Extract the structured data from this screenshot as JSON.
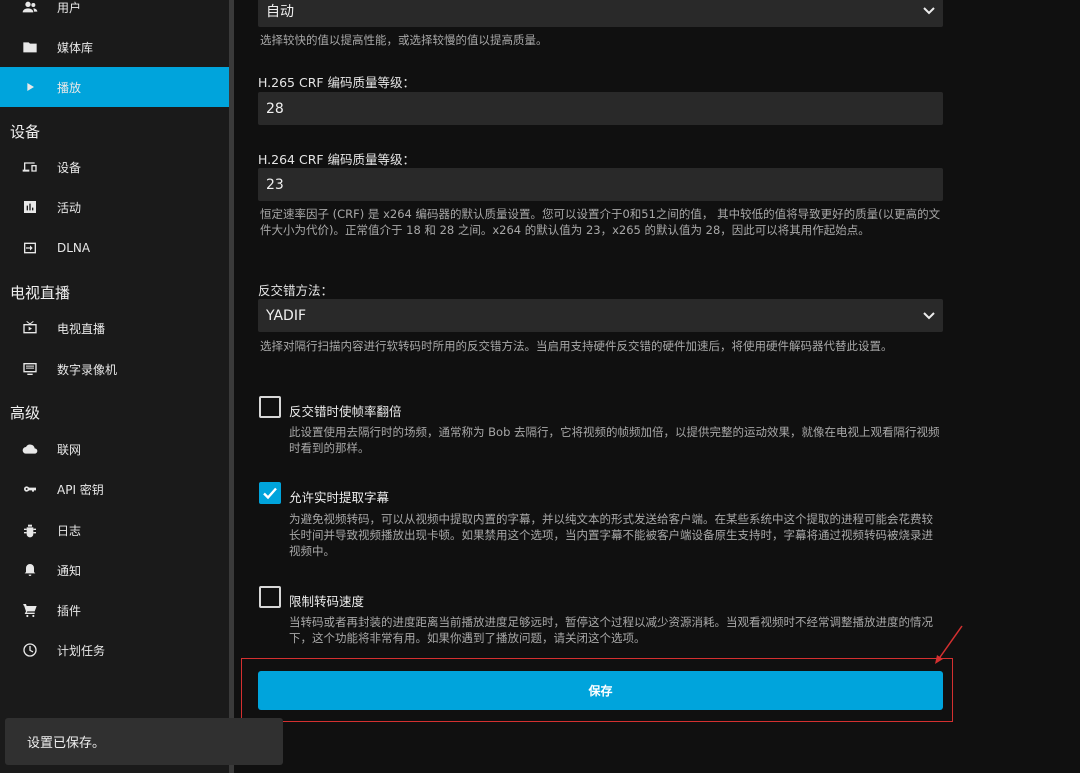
{
  "sidebar": {
    "items": [
      {
        "label": "用户",
        "icon": "users-icon",
        "active": false
      },
      {
        "label": "媒体库",
        "icon": "folder-icon",
        "active": false
      },
      {
        "label": "播放",
        "icon": "play-icon",
        "active": true
      }
    ],
    "sections": [
      {
        "title": "设备",
        "items": [
          {
            "label": "设备",
            "icon": "devices-icon"
          },
          {
            "label": "活动",
            "icon": "activity-icon"
          },
          {
            "label": "DLNA",
            "icon": "dlna-icon"
          }
        ]
      },
      {
        "title": "电视直播",
        "items": [
          {
            "label": "电视直播",
            "icon": "live-tv-icon"
          },
          {
            "label": "数字录像机",
            "icon": "dvr-icon"
          }
        ]
      },
      {
        "title": "高级",
        "items": [
          {
            "label": "联网",
            "icon": "cloud-icon"
          },
          {
            "label": "API 密钥",
            "icon": "key-icon"
          },
          {
            "label": "日志",
            "icon": "bug-icon"
          },
          {
            "label": "通知",
            "icon": "bell-icon"
          },
          {
            "label": "插件",
            "icon": "cart-icon"
          },
          {
            "label": "计划任务",
            "icon": "clock-icon"
          }
        ]
      }
    ]
  },
  "form": {
    "preset": {
      "value": "自动",
      "help": "选择较快的值以提高性能，或选择较慢的值以提高质量。"
    },
    "h265_crf": {
      "label": "H.265 CRF 编码质量等级：",
      "value": "28"
    },
    "h264_crf": {
      "label": "H.264 CRF 编码质量等级：",
      "value": "23",
      "help": "恒定速率因子 (CRF) 是 x264 编码器的默认质量设置。您可以设置介于0和51之间的值， 其中较低的值将导致更好的质量(以更高的文件大小为代价)。正常值介于 18 和 28 之间。x264 的默认值为 23，x265 的默认值为 28，因此可以将其用作起始点。"
    },
    "deinterlace": {
      "label": "反交错方法：",
      "value": "YADIF",
      "help": "选择对隔行扫描内容进行软转码时所用的反交错方法。当启用支持硬件反交错的硬件加速后，将使用硬件解码器代替此设置。"
    },
    "double_rate": {
      "label": "反交错时使帧率翻倍",
      "checked": false,
      "help": "此设置使用去隔行时的场频，通常称为 Bob 去隔行，它将视频的帧频加倍，以提供完整的运动效果，就像在电视上观看隔行视频时看到的那样。"
    },
    "extract_subs": {
      "label": "允许实时提取字幕",
      "checked": true,
      "help": "为避免视频转码，可以从视频中提取内置的字幕，并以纯文本的形式发送给客户端。在某些系统中这个提取的进程可能会花费较长时间并导致视频播放出现卡顿。如果禁用这个选项，当内置字幕不能被客户端设备原生支持时，字幕将通过视频转码被烧录进视频中。"
    },
    "throttle": {
      "label": "限制转码速度",
      "checked": false,
      "help": "当转码或者再封装的进度距离当前播放进度足够远时，暂停这个过程以减少资源消耗。当观看视频时不经常调整播放进度的情况下，这个功能将非常有用。如果你遇到了播放问题，请关闭这个选项。"
    },
    "save_label": "保存"
  },
  "toast": {
    "message": "设置已保存。"
  },
  "colors": {
    "accent": "#00a4dc",
    "annotation": "#d43030"
  }
}
